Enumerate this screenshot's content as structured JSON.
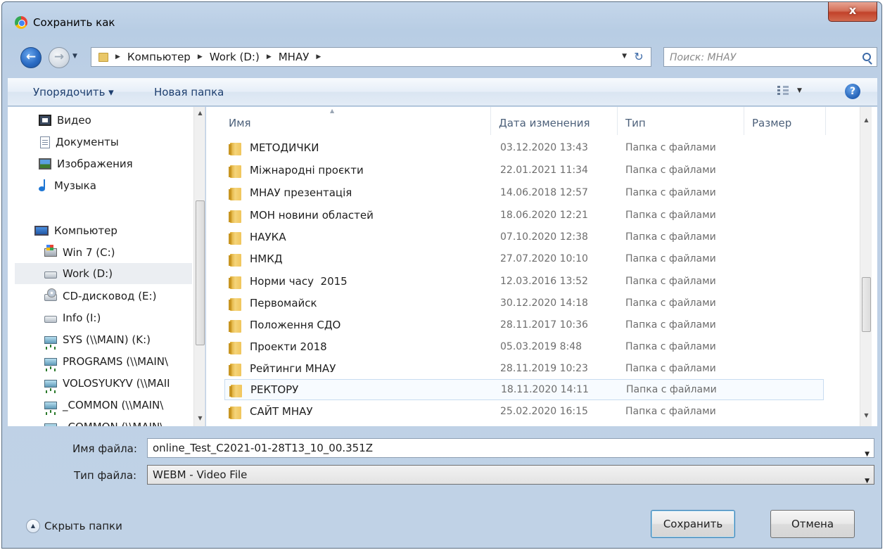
{
  "window": {
    "title": "Сохранить как",
    "close_label": "x"
  },
  "nav": {
    "back_icon": "back-arrow-icon",
    "forward_icon": "forward-arrow-icon"
  },
  "address": {
    "crumbs": [
      "Компьютер",
      "Work (D:)",
      "МНАУ"
    ]
  },
  "search": {
    "placeholder": "Поиск: МНАУ"
  },
  "toolbar": {
    "organize_label": "Упорядочить ▾",
    "new_folder_label": "Новая папка"
  },
  "sidebar": {
    "items": [
      {
        "label": "Видео",
        "icon": "video-icon"
      },
      {
        "label": "Документы",
        "icon": "documents-icon"
      },
      {
        "label": "Изображения",
        "icon": "images-icon"
      },
      {
        "label": "Музыка",
        "icon": "music-icon"
      },
      {
        "label": "Компьютер",
        "icon": "computer-icon"
      },
      {
        "label": "Win 7 (C:)",
        "icon": "system-drive-icon"
      },
      {
        "label": "Work (D:)",
        "icon": "drive-icon",
        "selected": true
      },
      {
        "label": "CD-дисковод (E:)",
        "icon": "cd-drive-icon"
      },
      {
        "label": "Info (I:)",
        "icon": "drive-icon"
      },
      {
        "label": "SYS (\\\\MAIN) (K:)",
        "icon": "network-drive-icon"
      },
      {
        "label": "PROGRAMS (\\\\MAIN\\",
        "icon": "network-drive-icon"
      },
      {
        "label": "VOLOSYUKYV (\\\\MAII",
        "icon": "network-drive-icon"
      },
      {
        "label": "_COMMON (\\\\MAIN\\",
        "icon": "network-drive-icon"
      },
      {
        "label": "_COMMON (\\\\MAIN\\",
        "icon": "network-drive-icon"
      }
    ]
  },
  "columns": {
    "name": "Имя",
    "date": "Дата изменения",
    "type": "Тип",
    "size": "Размер"
  },
  "files": [
    {
      "name": "МЕТОДИЧКИ",
      "date": "03.12.2020 13:43",
      "type": "Папка с файлами"
    },
    {
      "name": "Міжнародні проєкти",
      "date": "22.01.2021 11:34",
      "type": "Папка с файлами"
    },
    {
      "name": "МНАУ презентація",
      "date": "14.06.2018 12:57",
      "type": "Папка с файлами"
    },
    {
      "name": "МОН новини областей",
      "date": "18.06.2020 12:21",
      "type": "Папка с файлами"
    },
    {
      "name": "НАУКА",
      "date": "07.10.2020 12:38",
      "type": "Папка с файлами"
    },
    {
      "name": "НМКД",
      "date": "27.07.2020 10:10",
      "type": "Папка с файлами"
    },
    {
      "name": "Норми часу  2015",
      "date": "12.03.2016 13:52",
      "type": "Папка с файлами"
    },
    {
      "name": "Первомайск",
      "date": "30.12.2020 14:18",
      "type": "Папка с файлами"
    },
    {
      "name": "Положення СДО",
      "date": "28.11.2017 10:36",
      "type": "Папка с файлами"
    },
    {
      "name": "Проекти 2018",
      "date": "05.03.2019 8:48",
      "type": "Папка с файлами"
    },
    {
      "name": "Рейтинги МНАУ",
      "date": "28.11.2019 10:23",
      "type": "Папка с файлами"
    },
    {
      "name": "РЕКТОРУ",
      "date": "18.11.2020 14:11",
      "type": "Папка с файлами",
      "selected": true
    },
    {
      "name": "САЙТ МНАУ",
      "date": "25.02.2020 16:15",
      "type": "Папка с файлами"
    }
  ],
  "form": {
    "filename_label": "Имя файла:",
    "filename_value": "online_Test_C2021-01-28T13_10_00.351Z",
    "filetype_label": "Тип файла:",
    "filetype_value": "WEBM - Video File"
  },
  "footer": {
    "hide_folders_label": "Скрыть папки",
    "save_label": "Сохранить",
    "cancel_label": "Отмена"
  }
}
